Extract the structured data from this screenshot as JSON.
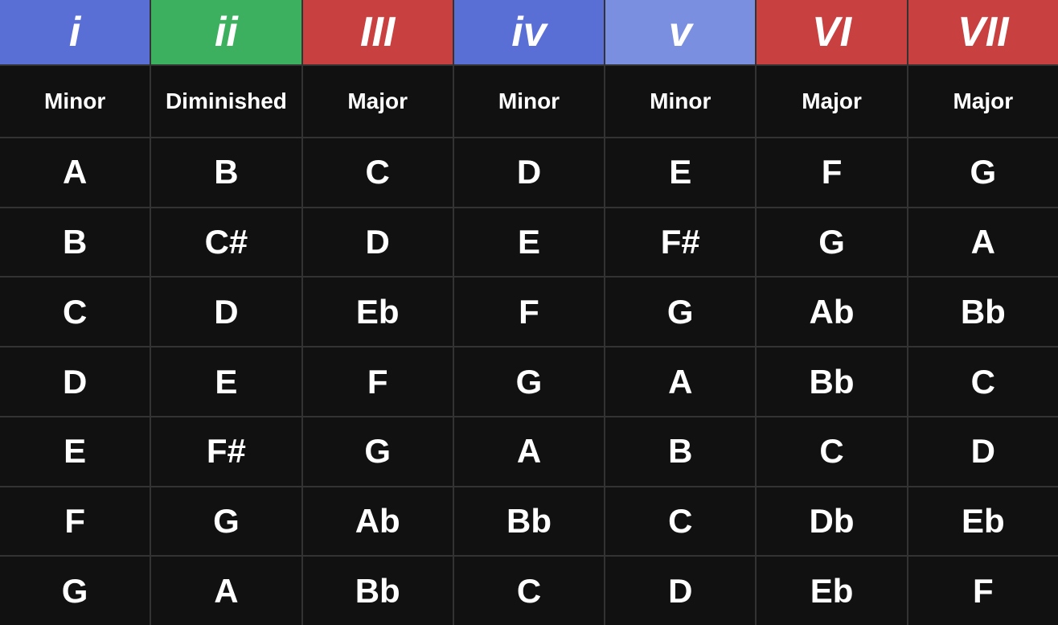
{
  "header": {
    "columns": [
      {
        "id": "i",
        "label": "i",
        "colorClass": "hdr-i",
        "roman": true
      },
      {
        "id": "ii",
        "label": "ii",
        "colorClass": "hdr-ii",
        "roman": true
      },
      {
        "id": "iii",
        "label": "III",
        "colorClass": "hdr-iii",
        "roman": true
      },
      {
        "id": "iv",
        "label": "iv",
        "colorClass": "hdr-iv",
        "roman": true
      },
      {
        "id": "v",
        "label": "v",
        "colorClass": "hdr-v",
        "roman": true
      },
      {
        "id": "vi",
        "label": "VI",
        "colorClass": "hdr-vi",
        "roman": true
      },
      {
        "id": "vii",
        "label": "VII",
        "colorClass": "hdr-vii",
        "roman": true
      }
    ]
  },
  "qualities": [
    "Minor",
    "Diminished",
    "Major",
    "Minor",
    "Minor",
    "Major",
    "Major"
  ],
  "rows": [
    [
      "A",
      "B",
      "C",
      "D",
      "E",
      "F",
      "G"
    ],
    [
      "B",
      "C#",
      "D",
      "E",
      "F#",
      "G",
      "A"
    ],
    [
      "C",
      "D",
      "Eb",
      "F",
      "G",
      "Ab",
      "Bb"
    ],
    [
      "D",
      "E",
      "F",
      "G",
      "A",
      "Bb",
      "C"
    ],
    [
      "E",
      "F#",
      "G",
      "A",
      "B",
      "C",
      "D"
    ],
    [
      "F",
      "G",
      "Ab",
      "Bb",
      "C",
      "Db",
      "Eb"
    ],
    [
      "G",
      "A",
      "Bb",
      "C",
      "D",
      "Eb",
      "F"
    ]
  ]
}
